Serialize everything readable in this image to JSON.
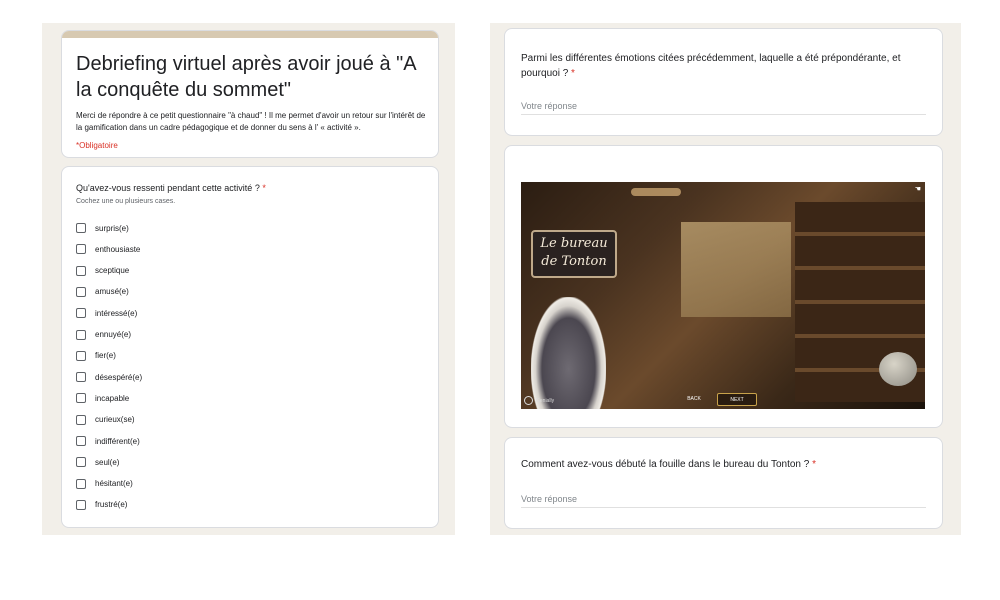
{
  "form": {
    "title": "Debriefing virtuel après avoir joué à \"A la conquête du sommet\"",
    "description": "Merci de répondre à ce petit questionnaire \"à chaud\" ! Il me permet d'avoir un retour sur l'intérêt de la gamification dans un cadre pédagogique et de donner du sens à l' « activité ».",
    "required_note": "*Obligatoire",
    "colors": {
      "header_accent": "#d7c9b1",
      "required": "#d93025",
      "background": "#f2efe9"
    }
  },
  "q1": {
    "title": "Qu'avez-vous ressenti pendant cette activité ?",
    "required": "*",
    "help": "Cochez une ou plusieurs cases.",
    "options": [
      "surpris(e)",
      "enthousiaste",
      "sceptique",
      "amusé(e)",
      "intéressé(e)",
      "ennuyé(e)",
      "fier(e)",
      "désespéré(e)",
      "incapable",
      "curieux(se)",
      "indifférent(e)",
      "seul(e)",
      "hésitant(e)",
      "frustré(e)"
    ]
  },
  "q2": {
    "title": "Parmi les différentes émotions citées précédemment, laquelle a été prépondérante, et pourquoi ?",
    "required": "*",
    "placeholder": "Votre réponse"
  },
  "image": {
    "sign_line1": "Le bureau",
    "sign_line2": "de Tonton",
    "back_label": "BACK",
    "next_label": "NEXT",
    "logo_text": "Genially"
  },
  "q3": {
    "title": "Comment avez-vous débuté la fouille dans le bureau du Tonton ?",
    "required": "*",
    "placeholder": "Votre réponse"
  }
}
